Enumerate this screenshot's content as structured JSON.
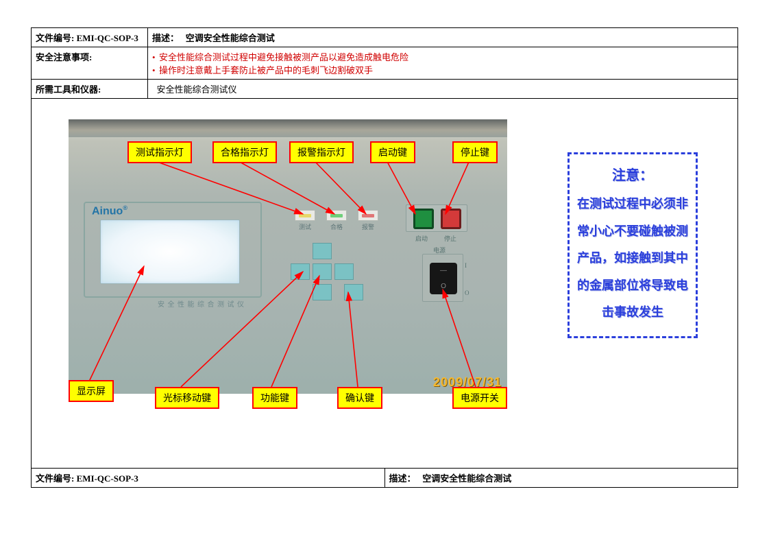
{
  "header": {
    "doc_no_label": "文件编号: EMI-QC-SOP-3",
    "desc_label": "描述：",
    "desc_value": "空调安全性能综合测试",
    "safety_label": "安全注意事项:",
    "safety_item1": "安全性能综合测试过程中避免接触被测产品以避免造成触电危险",
    "safety_item2": "操作时注意戴上手套防止被产品中的毛刺飞边割破双手",
    "tools_label": "所需工具和仪器:",
    "tools_value": "安全性能综合测试仪"
  },
  "callouts_top": {
    "c1": "测试指示灯",
    "c2": "合格指示灯",
    "c3": "报警指示灯",
    "c4": "启动键",
    "c5": "停止键"
  },
  "callouts_bottom": {
    "c1": "显示屏",
    "c2": "光标移动键",
    "c3": "功能键",
    "c4": "确认键",
    "c5": "电源开关"
  },
  "photo": {
    "brand": "Ainuo",
    "sublabel": "安 全 性 能 综 合 测 试 仪",
    "ind1": "测试",
    "ind2": "合格",
    "ind3": "报警",
    "start_label": "启动",
    "stop_label": "停止",
    "pwr_label": "电源",
    "timestamp": "2009/07/31"
  },
  "notice": {
    "title": "注意：",
    "body": "在测试过程中必须非常小心不要碰触被测产品，如接触到其中的金属部位将导致电击事故发生"
  },
  "footer": {
    "doc_no_label": "文件编号: EMI-QC-SOP-3",
    "desc_label": "描述：",
    "desc_value": "空调安全性能综合测试"
  }
}
